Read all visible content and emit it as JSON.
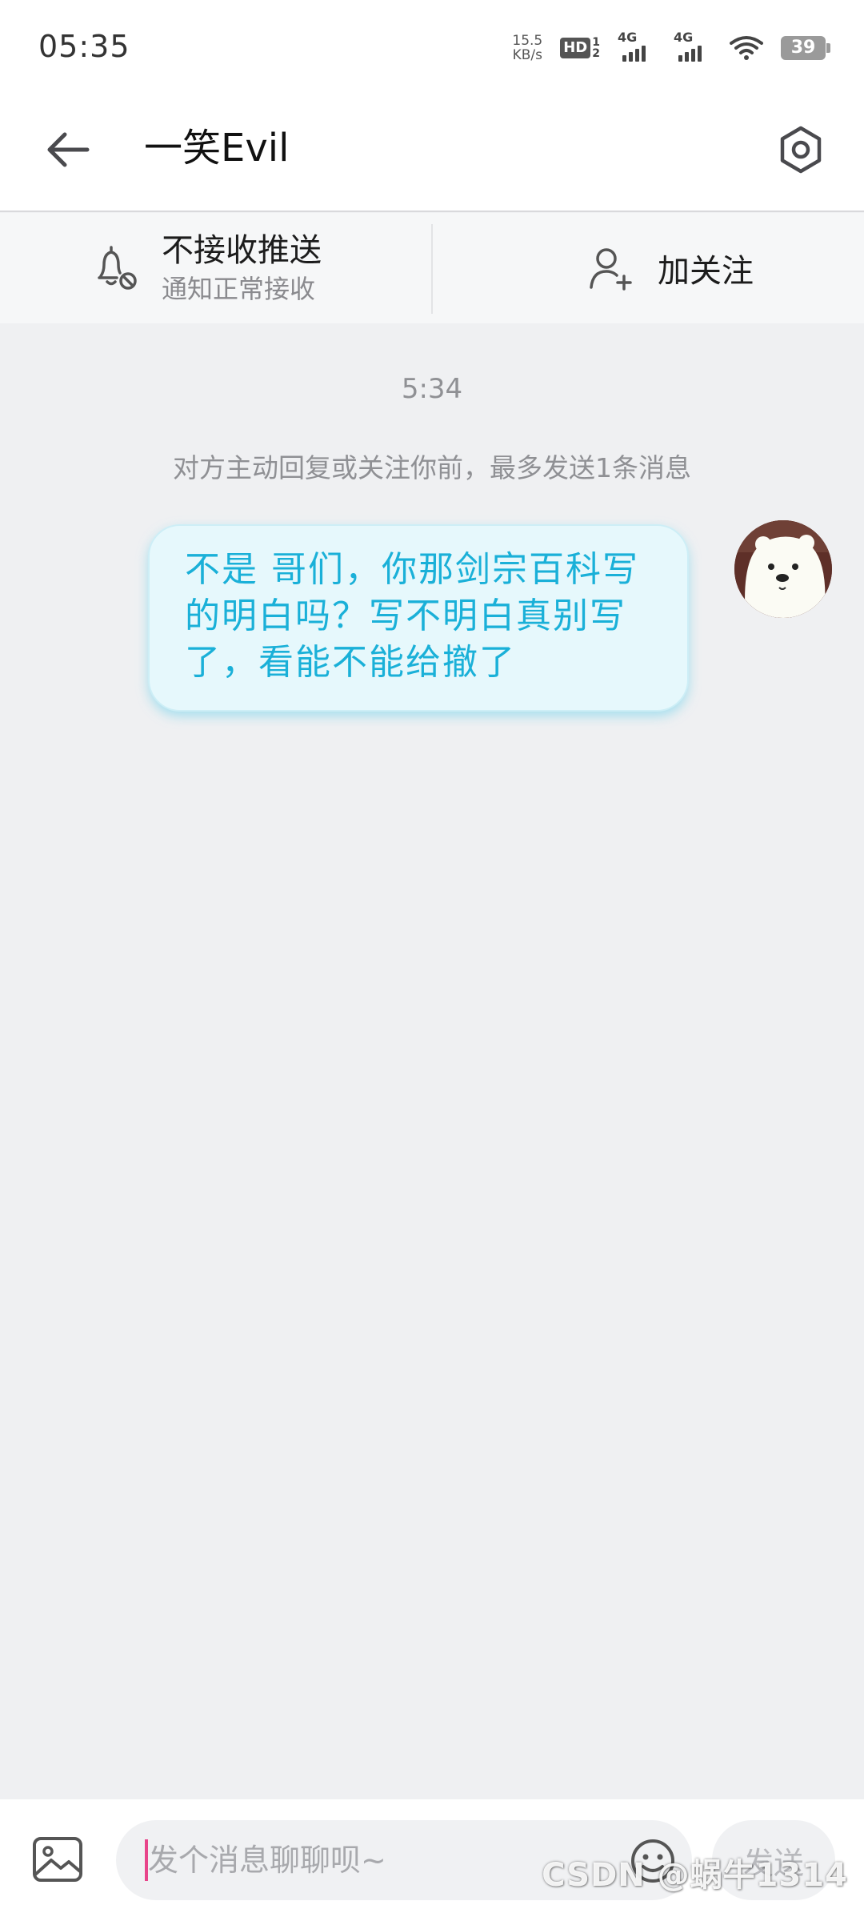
{
  "status_bar": {
    "time": "05:35",
    "net_speed_value": "15.5",
    "net_speed_unit": "KB/s",
    "hd_label": "HD",
    "hd_sub_top": "1",
    "hd_sub_bottom": "2",
    "sim1_label": "4G",
    "sim2_label": "4G",
    "battery_level": "39"
  },
  "header": {
    "title": "一笑Evil",
    "back_icon": "arrow-left-icon",
    "settings_icon": "hexagon-settings-icon"
  },
  "action_bar": {
    "push_title": "不接收推送",
    "push_subtitle": "通知正常接收",
    "push_icon": "bell-off-icon",
    "follow_label": "加关注",
    "follow_icon": "user-add-icon"
  },
  "conversation": {
    "timestamp": "5:34",
    "notice": "对方主动回复或关注你前，最多发送1条消息",
    "messages": [
      {
        "sender": "self",
        "text": "不是 哥们，你那剑宗百科写的明白吗？写不明白真别写了，看能不能给撤了"
      }
    ]
  },
  "input_bar": {
    "placeholder": "发个消息聊聊呗~",
    "send_label": "发送",
    "image_icon": "image-icon",
    "emoji_icon": "emoji-icon"
  },
  "watermark": "CSDN @蜗牛1314",
  "colors": {
    "accent": "#1ab0d8",
    "bubble_bg": "#e6f8fc",
    "caret": "#e8458a",
    "page_bg": "#eff0f2"
  }
}
